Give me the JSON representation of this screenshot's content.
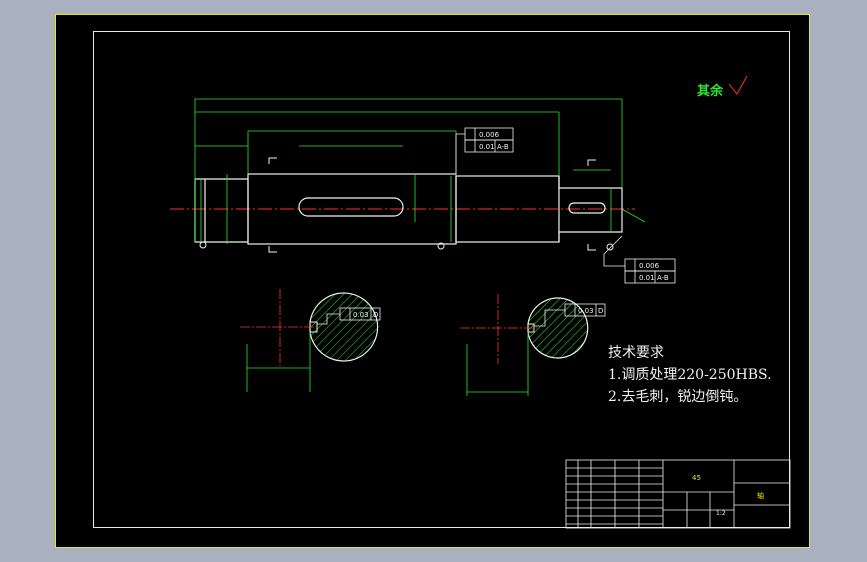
{
  "drawing": {
    "roughness_note": "其余",
    "tech_requirements": {
      "title": "技术要求",
      "items": [
        "1.调质处理220-250HBS.",
        "2.去毛刺，锐边倒钝。"
      ]
    },
    "tolerance_frames": {
      "upper_cyl": "0.006",
      "upper_runout": "0.01",
      "upper_datum": "A-B",
      "lower_cyl": "0.006",
      "lower_runout": "0.01",
      "lower_datum": "A-B",
      "section1_sym": "0.03",
      "section1_datum": "D",
      "section2_sym": "0.03",
      "section2_datum": "D"
    },
    "title_block": {
      "material": "45",
      "scale": "1:2",
      "part_name": "轴"
    }
  },
  "colors": {
    "outline": "#f0f0f0",
    "dimension": "#2ee82e",
    "centerline": "#ff3030",
    "frame_yellow": "#e8e800",
    "hatch": "#2ee82e"
  }
}
